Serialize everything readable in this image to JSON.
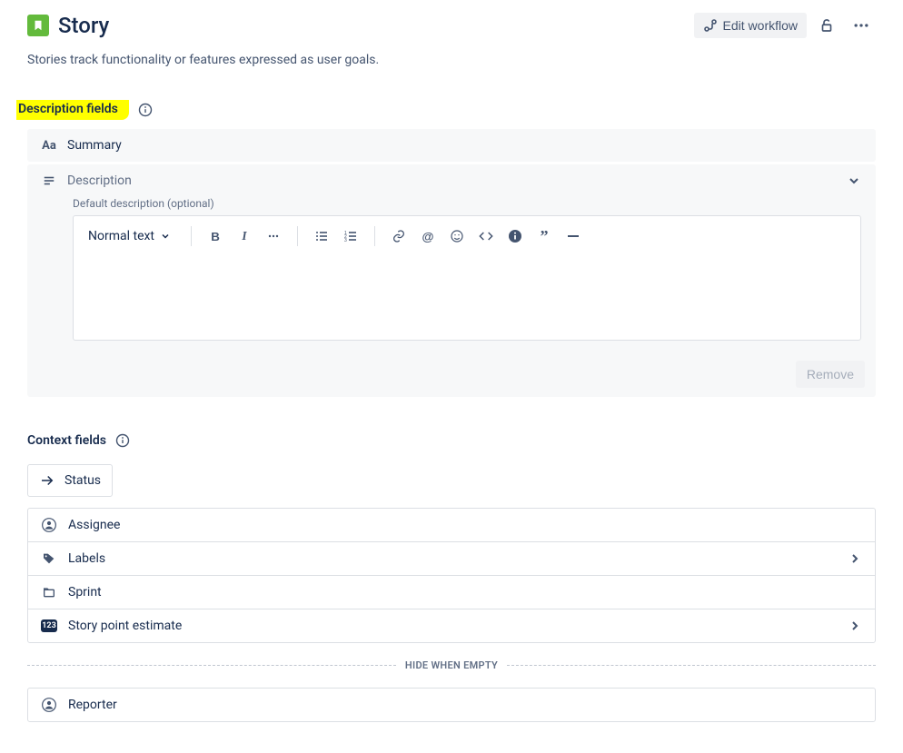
{
  "header": {
    "title": "Story",
    "editWorkflow": "Edit workflow"
  },
  "subtitle": "Stories track functionality or features expressed as user goals.",
  "descSection": {
    "title": "Description fields",
    "summary": "Summary",
    "description": "Description",
    "helper": "Default description (optional)",
    "formatLabel": "Normal text",
    "removeLabel": "Remove"
  },
  "contextSection": {
    "title": "Context fields",
    "status": "Status",
    "items": [
      {
        "icon": "assignee",
        "label": "Assignee",
        "expandable": false
      },
      {
        "icon": "labels",
        "label": "Labels",
        "expandable": true
      },
      {
        "icon": "sprint",
        "label": "Sprint",
        "expandable": false
      },
      {
        "icon": "estimate",
        "label": "Story point estimate",
        "expandable": true
      }
    ],
    "divider": "HIDE WHEN EMPTY",
    "reporter": "Reporter"
  }
}
